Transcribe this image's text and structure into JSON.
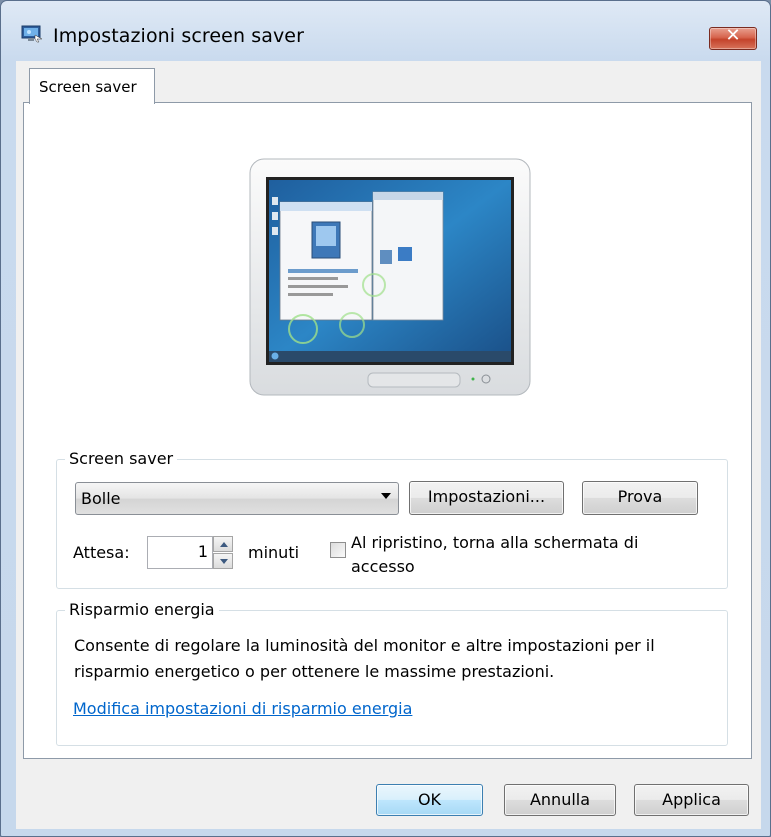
{
  "window": {
    "title": "Impostazioni screen saver",
    "close_symbol": "✕"
  },
  "tabs": [
    {
      "label": "Screen saver",
      "selected": true
    }
  ],
  "screen_saver": {
    "group_label": "Screen saver",
    "selected": "Bolle",
    "settings_button": "Impostazioni...",
    "preview_button": "Prova",
    "wait_label": "Attesa:",
    "wait_value": "1",
    "wait_unit": "minuti",
    "resume_checkbox_label_line1": "Al ripristino, torna alla schermata di",
    "resume_checkbox_label_line2": "accesso",
    "resume_checked": false
  },
  "power": {
    "group_label": "Risparmio energia",
    "description_line1": "Consente di regolare la luminosità del monitor e altre impostazioni per il",
    "description_line2": "risparmio energetico o per ottenere le massime prestazioni.",
    "link": "Modifica impostazioni di risparmio energia"
  },
  "buttons": {
    "ok": "OK",
    "cancel": "Annulla",
    "apply": "Applica"
  },
  "colors": {
    "link": "#0066cc",
    "close_button": "#c4432b"
  }
}
